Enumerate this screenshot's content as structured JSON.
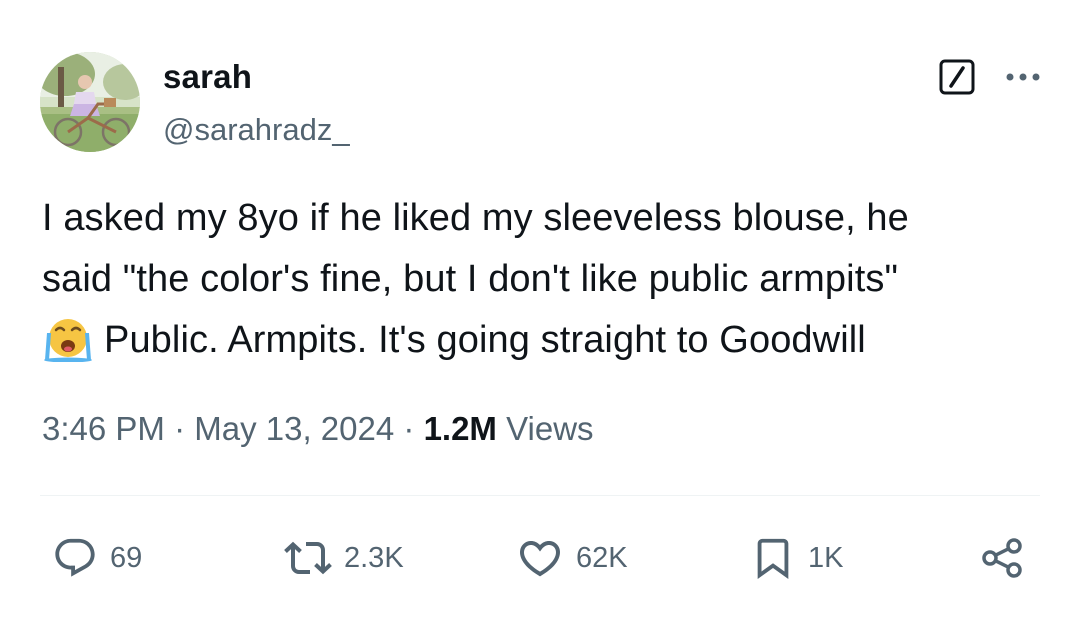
{
  "author": {
    "display_name": "sarah",
    "handle": "@sarahradz_"
  },
  "header_icons": [
    "grok-icon",
    "more-icon"
  ],
  "tweet": {
    "lines": [
      "I asked my 8yo if he liked my sleeveless blouse, he",
      "said \"the color's fine, but I don't like public armpits\"",
      "Public. Armpits. It's going straight to Goodwill"
    ],
    "emoji": "loudly-crying-face"
  },
  "meta": {
    "time": "3:46 PM",
    "separator": "·",
    "date": "May 13, 2024",
    "views_count": "1.2M",
    "views_label": "Views"
  },
  "actions": {
    "replies": "69",
    "reposts": "2.3K",
    "likes": "62K",
    "bookmarks": "1K"
  },
  "colors": {
    "text": "#0f1419",
    "secondary": "#536471",
    "divider": "#eff3f4"
  }
}
